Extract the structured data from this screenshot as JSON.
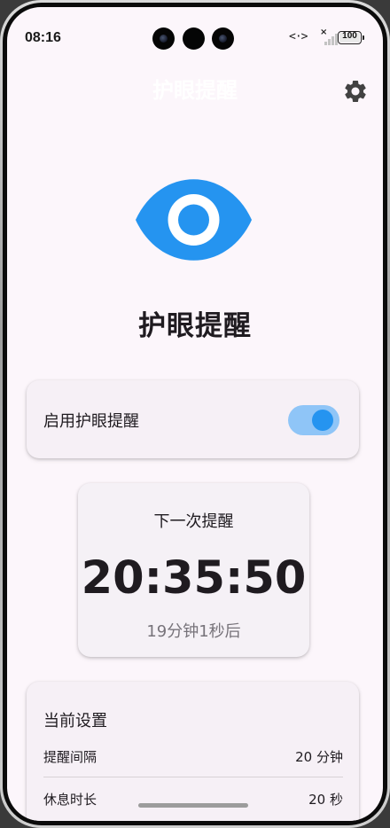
{
  "status_bar": {
    "time": "08:16",
    "data_indicator": "<·>",
    "signal_mark": "×",
    "battery": "100"
  },
  "app_bar": {
    "title": "护眼提醒",
    "settings_icon": "gear-icon"
  },
  "hero": {
    "icon": "eye-icon",
    "title": "护眼提醒"
  },
  "toggle_card": {
    "label": "启用护眼提醒",
    "enabled": true
  },
  "next_reminder": {
    "title": "下一次提醒",
    "time": "20:35:50",
    "remaining": "19分钟1秒后"
  },
  "current_settings": {
    "title": "当前设置",
    "rows": [
      {
        "label": "提醒间隔",
        "value": "20 分钟"
      },
      {
        "label": "休息时长",
        "value": "20 秒"
      }
    ]
  },
  "colors": {
    "accent": "#2594f0",
    "accent_light": "#8fc5f7",
    "background": "#fcf6fb",
    "card": "#f6f0f6"
  }
}
